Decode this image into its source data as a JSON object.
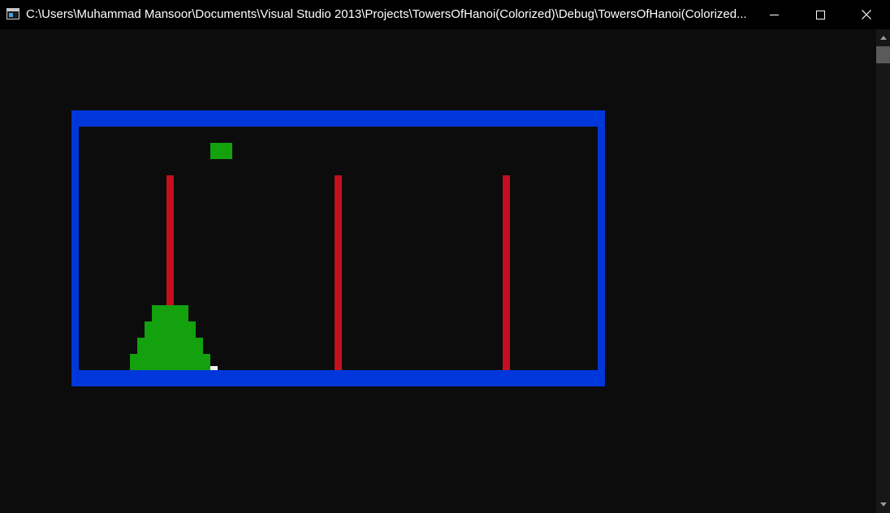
{
  "window": {
    "title": "C:\\Users\\Muhammad Mansoor\\Documents\\Visual Studio 2013\\Projects\\TowersOfHanoi(Colorized)\\Debug\\TowersOfHanoi(Colorized..."
  },
  "icons": {
    "app": "console-app-icon",
    "minimize": "minimize-icon",
    "maximize": "maximize-icon",
    "close": "close-icon"
  },
  "game": {
    "pegs": 3,
    "disks_on_first_peg": 4,
    "held_disks": 1,
    "colors": {
      "background": "#0c0c0c",
      "frame": "#0037da",
      "peg": "#c50f1f",
      "disk": "#13a10e",
      "cursor": "#f2f2f2"
    }
  }
}
